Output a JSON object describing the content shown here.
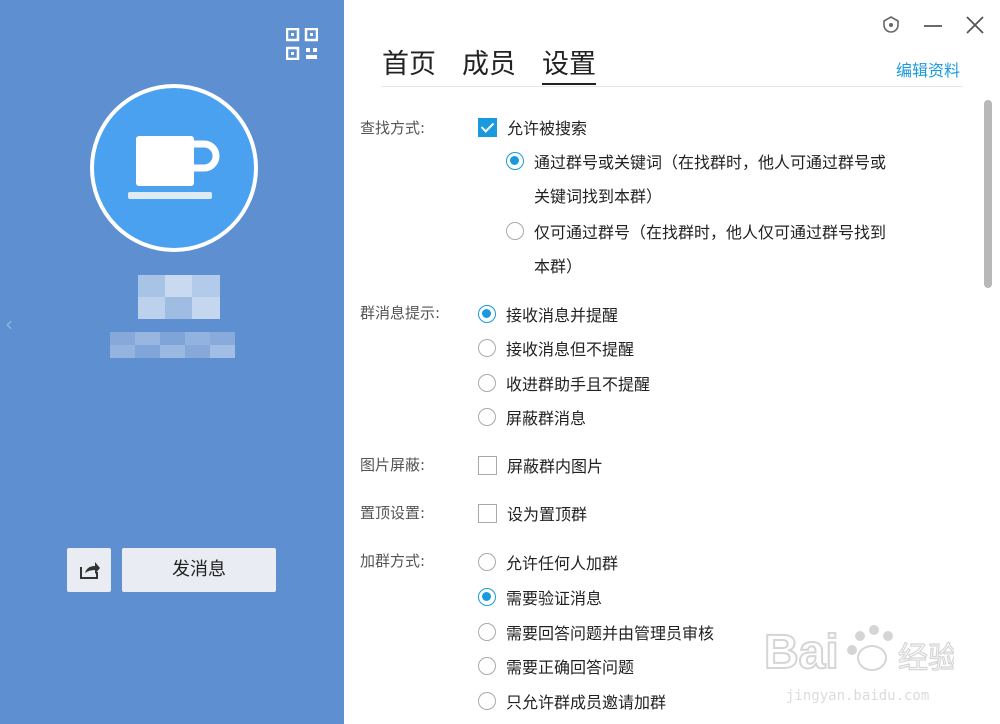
{
  "sidebar": {
    "send_label": "发消息"
  },
  "tabs": [
    {
      "label": "首页",
      "active": false
    },
    {
      "label": "成员",
      "active": false
    },
    {
      "label": "设置",
      "active": true
    }
  ],
  "header": {
    "edit_label": "编辑资料"
  },
  "settings": {
    "search": {
      "label": "查找方式:",
      "allow_search": {
        "label": "允许被搜索",
        "checked": true
      },
      "options": [
        {
          "line1": "通过群号或关键词（在找群时，他人可通过群号或",
          "line2": "关键词找到本群）",
          "selected": true
        },
        {
          "line1": "仅可通过群号（在找群时，他人仅可通过群号找到",
          "line2": "本群）",
          "selected": false
        }
      ]
    },
    "notify": {
      "label": "群消息提示:",
      "options": [
        {
          "label": "接收消息并提醒",
          "selected": true
        },
        {
          "label": "接收消息但不提醒",
          "selected": false
        },
        {
          "label": "收进群助手且不提醒",
          "selected": false
        },
        {
          "label": "屏蔽群消息",
          "selected": false
        }
      ]
    },
    "image_block": {
      "label": "图片屏蔽:",
      "option": "屏蔽群内图片",
      "checked": false
    },
    "pin": {
      "label": "置顶设置:",
      "option": "设为置顶群",
      "checked": false
    },
    "join": {
      "label": "加群方式:",
      "options": [
        {
          "label": "允许任何人加群",
          "selected": false
        },
        {
          "label": "需要验证消息",
          "selected": true
        },
        {
          "label": "需要回答问题并由管理员审核",
          "selected": false
        },
        {
          "label": "需要正确回答问题",
          "selected": false
        },
        {
          "label": "只允许群成员邀请加群",
          "selected": false
        }
      ]
    }
  },
  "watermark": {
    "logo": "Bai经验",
    "url": "jingyan.baidu.com"
  },
  "colors": {
    "sidebar_bg": "#5e8fd0",
    "accent": "#1a9ade",
    "avatar_bg": "#4aa1ef"
  }
}
